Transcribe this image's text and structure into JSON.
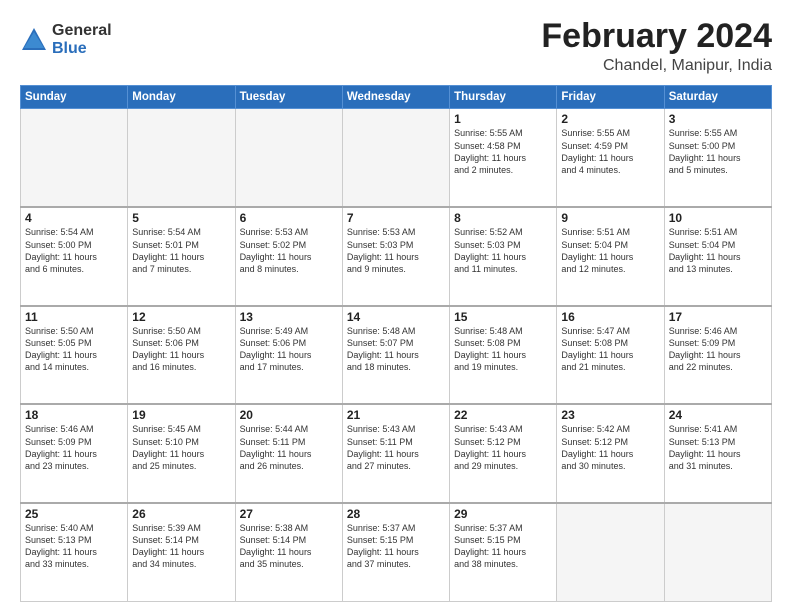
{
  "logo": {
    "general": "General",
    "blue": "Blue"
  },
  "title": "February 2024",
  "subtitle": "Chandel, Manipur, India",
  "days": [
    "Sunday",
    "Monday",
    "Tuesday",
    "Wednesday",
    "Thursday",
    "Friday",
    "Saturday"
  ],
  "weeks": [
    [
      {
        "num": "",
        "text": ""
      },
      {
        "num": "",
        "text": ""
      },
      {
        "num": "",
        "text": ""
      },
      {
        "num": "",
        "text": ""
      },
      {
        "num": "1",
        "text": "Sunrise: 5:55 AM\nSunset: 4:58 PM\nDaylight: 11 hours\nand 2 minutes."
      },
      {
        "num": "2",
        "text": "Sunrise: 5:55 AM\nSunset: 4:59 PM\nDaylight: 11 hours\nand 4 minutes."
      },
      {
        "num": "3",
        "text": "Sunrise: 5:55 AM\nSunset: 5:00 PM\nDaylight: 11 hours\nand 5 minutes."
      }
    ],
    [
      {
        "num": "4",
        "text": "Sunrise: 5:54 AM\nSunset: 5:00 PM\nDaylight: 11 hours\nand 6 minutes."
      },
      {
        "num": "5",
        "text": "Sunrise: 5:54 AM\nSunset: 5:01 PM\nDaylight: 11 hours\nand 7 minutes."
      },
      {
        "num": "6",
        "text": "Sunrise: 5:53 AM\nSunset: 5:02 PM\nDaylight: 11 hours\nand 8 minutes."
      },
      {
        "num": "7",
        "text": "Sunrise: 5:53 AM\nSunset: 5:03 PM\nDaylight: 11 hours\nand 9 minutes."
      },
      {
        "num": "8",
        "text": "Sunrise: 5:52 AM\nSunset: 5:03 PM\nDaylight: 11 hours\nand 11 minutes."
      },
      {
        "num": "9",
        "text": "Sunrise: 5:51 AM\nSunset: 5:04 PM\nDaylight: 11 hours\nand 12 minutes."
      },
      {
        "num": "10",
        "text": "Sunrise: 5:51 AM\nSunset: 5:04 PM\nDaylight: 11 hours\nand 13 minutes."
      }
    ],
    [
      {
        "num": "11",
        "text": "Sunrise: 5:50 AM\nSunset: 5:05 PM\nDaylight: 11 hours\nand 14 minutes."
      },
      {
        "num": "12",
        "text": "Sunrise: 5:50 AM\nSunset: 5:06 PM\nDaylight: 11 hours\nand 16 minutes."
      },
      {
        "num": "13",
        "text": "Sunrise: 5:49 AM\nSunset: 5:06 PM\nDaylight: 11 hours\nand 17 minutes."
      },
      {
        "num": "14",
        "text": "Sunrise: 5:48 AM\nSunset: 5:07 PM\nDaylight: 11 hours\nand 18 minutes."
      },
      {
        "num": "15",
        "text": "Sunrise: 5:48 AM\nSunset: 5:08 PM\nDaylight: 11 hours\nand 19 minutes."
      },
      {
        "num": "16",
        "text": "Sunrise: 5:47 AM\nSunset: 5:08 PM\nDaylight: 11 hours\nand 21 minutes."
      },
      {
        "num": "17",
        "text": "Sunrise: 5:46 AM\nSunset: 5:09 PM\nDaylight: 11 hours\nand 22 minutes."
      }
    ],
    [
      {
        "num": "18",
        "text": "Sunrise: 5:46 AM\nSunset: 5:09 PM\nDaylight: 11 hours\nand 23 minutes."
      },
      {
        "num": "19",
        "text": "Sunrise: 5:45 AM\nSunset: 5:10 PM\nDaylight: 11 hours\nand 25 minutes."
      },
      {
        "num": "20",
        "text": "Sunrise: 5:44 AM\nSunset: 5:11 PM\nDaylight: 11 hours\nand 26 minutes."
      },
      {
        "num": "21",
        "text": "Sunrise: 5:43 AM\nSunset: 5:11 PM\nDaylight: 11 hours\nand 27 minutes."
      },
      {
        "num": "22",
        "text": "Sunrise: 5:43 AM\nSunset: 5:12 PM\nDaylight: 11 hours\nand 29 minutes."
      },
      {
        "num": "23",
        "text": "Sunrise: 5:42 AM\nSunset: 5:12 PM\nDaylight: 11 hours\nand 30 minutes."
      },
      {
        "num": "24",
        "text": "Sunrise: 5:41 AM\nSunset: 5:13 PM\nDaylight: 11 hours\nand 31 minutes."
      }
    ],
    [
      {
        "num": "25",
        "text": "Sunrise: 5:40 AM\nSunset: 5:13 PM\nDaylight: 11 hours\nand 33 minutes."
      },
      {
        "num": "26",
        "text": "Sunrise: 5:39 AM\nSunset: 5:14 PM\nDaylight: 11 hours\nand 34 minutes."
      },
      {
        "num": "27",
        "text": "Sunrise: 5:38 AM\nSunset: 5:14 PM\nDaylight: 11 hours\nand 35 minutes."
      },
      {
        "num": "28",
        "text": "Sunrise: 5:37 AM\nSunset: 5:15 PM\nDaylight: 11 hours\nand 37 minutes."
      },
      {
        "num": "29",
        "text": "Sunrise: 5:37 AM\nSunset: 5:15 PM\nDaylight: 11 hours\nand 38 minutes."
      },
      {
        "num": "",
        "text": ""
      },
      {
        "num": "",
        "text": ""
      }
    ]
  ]
}
